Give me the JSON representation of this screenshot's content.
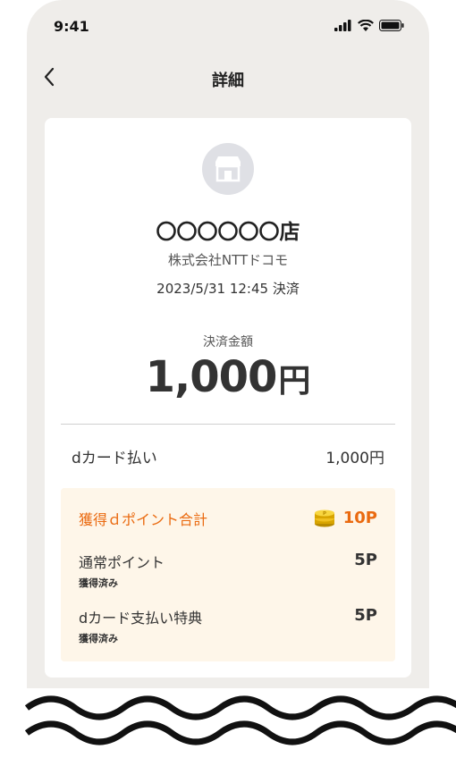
{
  "status_bar": {
    "time": "9:41"
  },
  "header": {
    "title": "詳細"
  },
  "receipt": {
    "shop_name": "〇〇〇〇〇〇店",
    "company": "株式会社NTTドコモ",
    "datetime": "2023/5/31 12:45 決済",
    "amount_label": "決済金額",
    "amount_value": "1,000",
    "amount_unit": "円",
    "payment_method": "dカード払い",
    "payment_amount": "1,000円"
  },
  "points": {
    "total_label": "獲得ｄポイント合計",
    "total_value": "10P",
    "rows": [
      {
        "name": "通常ポイント",
        "status": "獲得済み",
        "value": "5P"
      },
      {
        "name": "dカード支払い特典",
        "status": "獲得済み",
        "value": "5P"
      }
    ]
  },
  "colors": {
    "accent_orange": "#ea6a10",
    "points_bg": "#fef6e9",
    "phone_bg": "#efedea"
  }
}
